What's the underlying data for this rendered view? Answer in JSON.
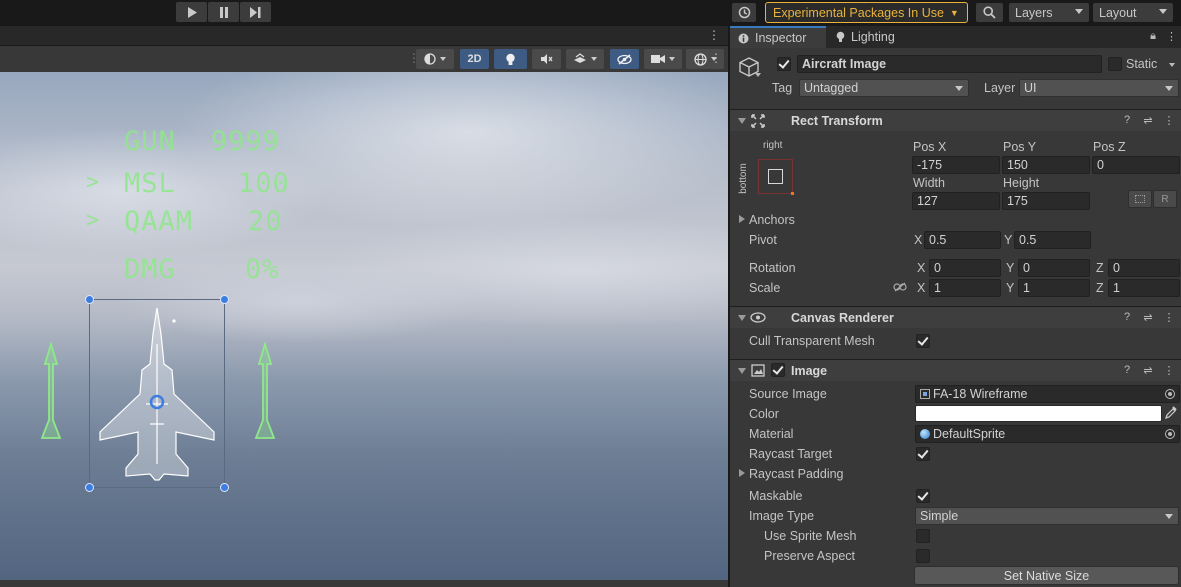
{
  "toolbar": {
    "experimental_label": "Experimental Packages In Use",
    "layers_label": "Layers",
    "layout_label": "Layout"
  },
  "scene": {
    "mode_2d": "2D",
    "hud": {
      "gun_label": "GUN",
      "gun_value": "9999",
      "msl_marker": ">",
      "msl_label": "MSL",
      "msl_value": "100",
      "qaam_marker": ">",
      "qaam_label": "QAAM",
      "qaam_value": "20",
      "dmg_label": "DMG",
      "dmg_value": "0%"
    },
    "hud_color": "#8fe88a"
  },
  "inspector": {
    "tabs": {
      "inspector": "Inspector",
      "lighting": "Lighting"
    },
    "object": {
      "name": "Aircraft Image",
      "active": true,
      "static_label": "Static",
      "tag_label": "Tag",
      "tag_value": "Untagged",
      "layer_label": "Layer",
      "layer_value": "UI"
    },
    "rect_transform": {
      "title": "Rect Transform",
      "anchor_h": "right",
      "anchor_v": "bottom",
      "pos_x_label": "Pos X",
      "pos_x": "-175",
      "pos_y_label": "Pos Y",
      "pos_y": "150",
      "pos_z_label": "Pos Z",
      "pos_z": "0",
      "width_label": "Width",
      "width": "127",
      "height_label": "Height",
      "height": "175",
      "r_button": "R",
      "anchors_label": "Anchors",
      "pivot_label": "Pivot",
      "pivot_x": "0.5",
      "pivot_y": "0.5",
      "rotation_label": "Rotation",
      "rot_x": "0",
      "rot_y": "0",
      "rot_z": "0",
      "scale_label": "Scale",
      "scale_x": "1",
      "scale_y": "1",
      "scale_z": "1",
      "axis_x": "X",
      "axis_y": "Y",
      "axis_z": "Z"
    },
    "canvas_renderer": {
      "title": "Canvas Renderer",
      "cull_label": "Cull Transparent Mesh",
      "cull": true
    },
    "image": {
      "title": "Image",
      "enabled": true,
      "source_label": "Source Image",
      "source_value": "FA-18 Wireframe",
      "color_label": "Color",
      "color_value": "#ffffff",
      "material_label": "Material",
      "material_value": "DefaultSprite",
      "raycast_target_label": "Raycast Target",
      "raycast_target": true,
      "raycast_padding_label": "Raycast Padding",
      "maskable_label": "Maskable",
      "maskable": true,
      "image_type_label": "Image Type",
      "image_type_value": "Simple",
      "use_sprite_mesh_label": "Use Sprite Mesh",
      "use_sprite_mesh": false,
      "preserve_aspect_label": "Preserve Aspect",
      "preserve_aspect": false,
      "set_native_size_label": "Set Native Size"
    }
  }
}
